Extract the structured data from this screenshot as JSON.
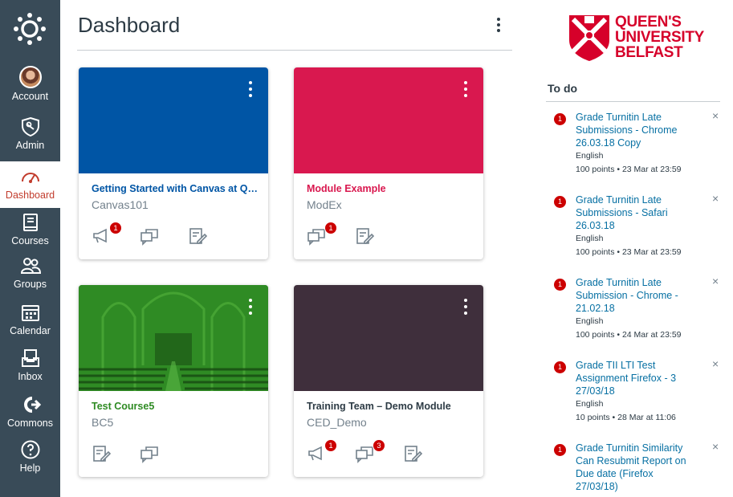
{
  "nav": {
    "items": [
      {
        "label": "Account",
        "icon": "avatar"
      },
      {
        "label": "Admin",
        "icon": "shield-icon"
      },
      {
        "label": "Dashboard",
        "icon": "dashboard-icon"
      },
      {
        "label": "Courses",
        "icon": "book-icon"
      },
      {
        "label": "Groups",
        "icon": "groups-icon"
      },
      {
        "label": "Calendar",
        "icon": "calendar-icon"
      },
      {
        "label": "Inbox",
        "icon": "inbox-icon"
      },
      {
        "label": "Commons",
        "icon": "commons-icon"
      },
      {
        "label": "Help",
        "icon": "help-icon"
      }
    ],
    "active": "Dashboard",
    "bg_color": "#394b58",
    "active_color": "#c23c2d"
  },
  "header": {
    "title": "Dashboard"
  },
  "logo": {
    "line1": "QUEEN'S",
    "line2": "UNIVERSITY",
    "line3": "BELFAST",
    "color": "#d6002a"
  },
  "cards": [
    {
      "title": "Getting Started with Canvas at Qu...",
      "code": "Canvas101",
      "color": "#0055a5",
      "title_color": "#0055a5",
      "actions": [
        {
          "icon": "announcements-icon",
          "badge": "1"
        },
        {
          "icon": "discussions-icon",
          "badge": ""
        },
        {
          "icon": "assignments-icon",
          "badge": ""
        }
      ]
    },
    {
      "title": "Module Example",
      "code": "ModEx",
      "color": "#d9184f",
      "title_color": "#d9184f",
      "actions": [
        {
          "icon": "discussions-icon",
          "badge": "1"
        },
        {
          "icon": "assignments-icon",
          "badge": ""
        }
      ]
    },
    {
      "title": "Test Course5",
      "code": "BC5",
      "color": "#2f8b24",
      "title_color": "#2f8b24",
      "actions": [
        {
          "icon": "assignments-icon",
          "badge": ""
        },
        {
          "icon": "discussions-icon",
          "badge": ""
        }
      ]
    },
    {
      "title": "Training Team – Demo Module",
      "code": "CED_Demo",
      "color": "#3f2f3c",
      "title_color": "#2d3b45",
      "actions": [
        {
          "icon": "announcements-icon",
          "badge": "1"
        },
        {
          "icon": "discussions-icon",
          "badge": "3"
        },
        {
          "icon": "assignments-icon",
          "badge": ""
        }
      ]
    }
  ],
  "todo": {
    "heading": "To do",
    "items": [
      {
        "badge": "1",
        "title": "Grade Turnitin Late Submissions - Chrome 26.03.18 Copy",
        "course": "English",
        "meta": "100 points • 23 Mar at 23:59",
        "close": "×"
      },
      {
        "badge": "1",
        "title": "Grade Turnitin Late Submissions - Safari 26.03.18",
        "course": "English",
        "meta": "100 points • 23 Mar at 23:59",
        "close": "×"
      },
      {
        "badge": "1",
        "title": "Grade Turnitin Late Submission - Chrome - 21.02.18",
        "course": "English",
        "meta": "100 points • 24 Mar at 23:59",
        "close": "×"
      },
      {
        "badge": "1",
        "title": "Grade TII LTI Test Assignment Firefox - 3 27/03/18",
        "course": "English",
        "meta": "10 points • 28 Mar at 11:06",
        "close": "×"
      },
      {
        "badge": "1",
        "title": "Grade Turnitin Similarity Can Resubmit Report on Due date (Firefox 27/03/18)",
        "course": "",
        "meta": "",
        "close": "×"
      }
    ]
  }
}
